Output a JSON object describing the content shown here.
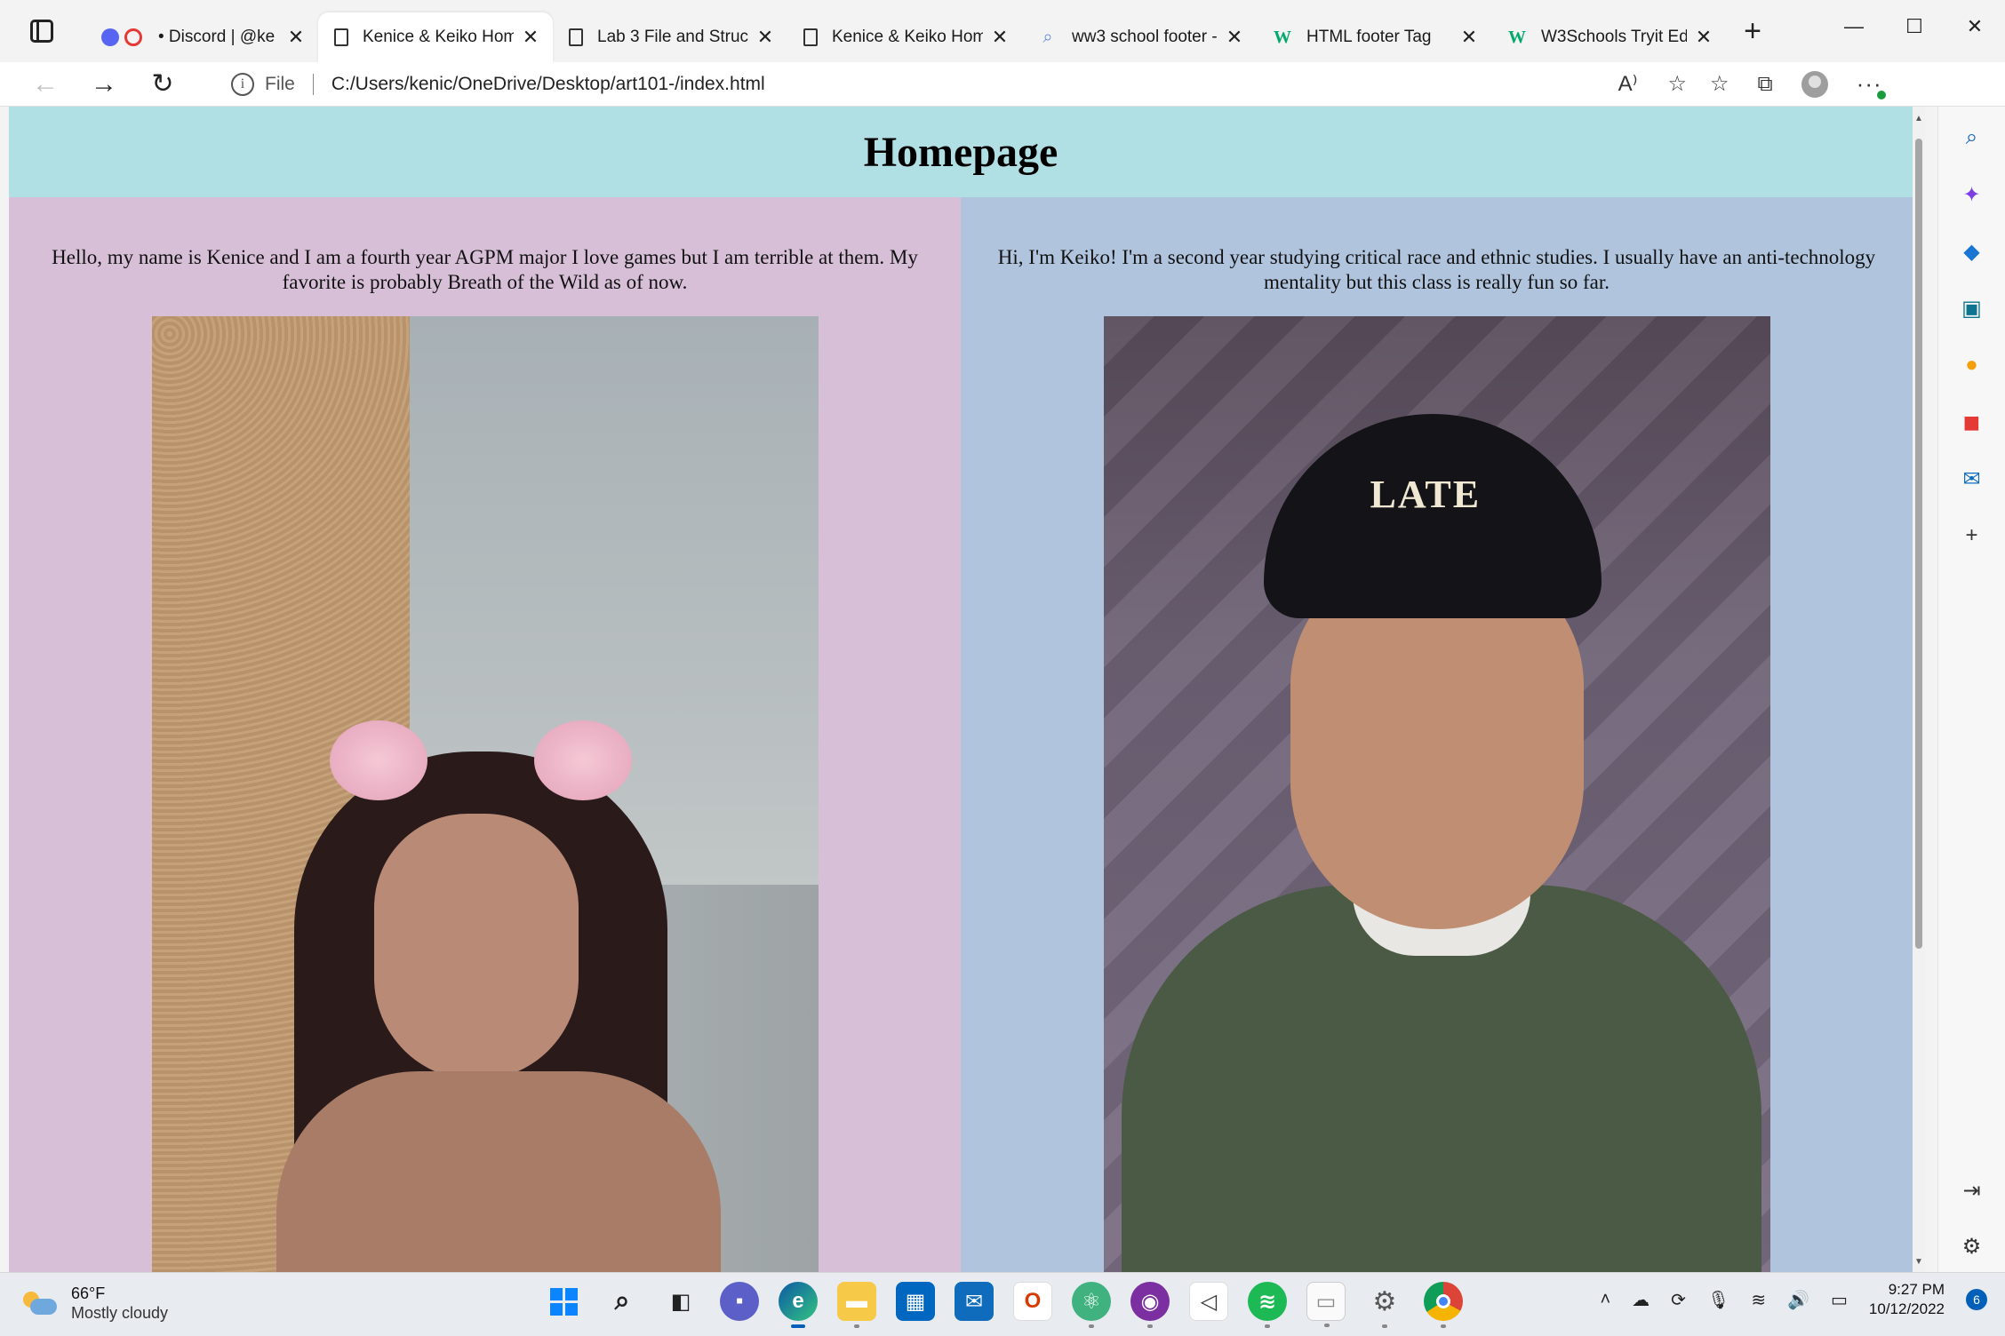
{
  "browser": {
    "tabs": [
      {
        "title": "• Discord | @ke",
        "icon": "discord-icon",
        "active": false
      },
      {
        "title": "Kenice & Keiko Hom",
        "icon": "document-icon",
        "active": true
      },
      {
        "title": "Lab 3 File and Struct",
        "icon": "document-icon",
        "active": false
      },
      {
        "title": "Kenice & Keiko Hom",
        "icon": "document-icon",
        "active": false
      },
      {
        "title": "ww3 school footer -",
        "icon": "search-icon",
        "active": false
      },
      {
        "title": "HTML footer Tag",
        "icon": "w3schools-icon",
        "active": false
      },
      {
        "title": "W3Schools Tryit Edit",
        "icon": "w3schools-icon",
        "active": false
      }
    ],
    "address": {
      "scheme": "File",
      "url": "C:/Users/kenic/OneDrive/Desktop/art101-/index.html"
    }
  },
  "page": {
    "header_title": "Homepage",
    "left": {
      "text": "Hello, my name is Kenice and I am a fourth year AGPM major I love games but I am terrible at them. My favorite is probably Breath of the Wild as of now.",
      "bg": "#d8bfd8"
    },
    "right": {
      "text": "Hi, I'm Keiko! I'm a second year studying critical race and ethnic studies. I usually have an anti-technology mentality but this class is really fun so far.",
      "cap_text": "LATE",
      "bg": "#b0c4de"
    },
    "header_bg": "#b0dfe4"
  },
  "taskbar": {
    "weather_temp": "66°F",
    "weather_condition": "Mostly cloudy",
    "time": "9:27 PM",
    "date": "10/12/2022",
    "notification_count": "6"
  }
}
